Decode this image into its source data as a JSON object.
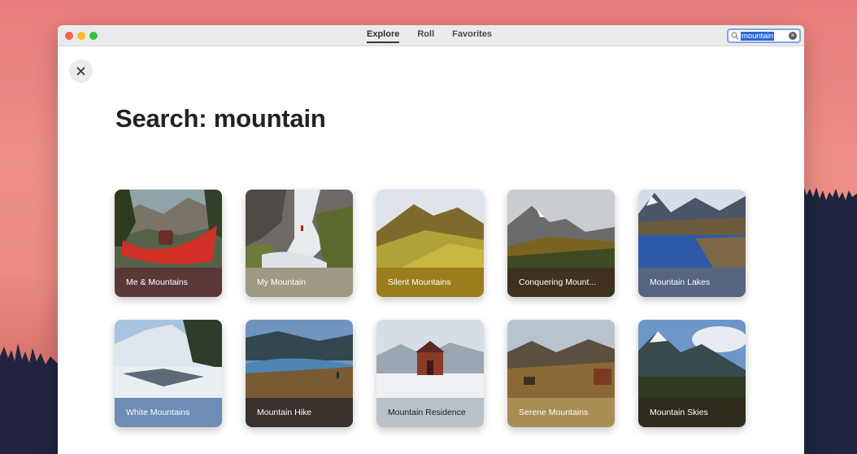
{
  "window": {
    "tabs": [
      {
        "label": "Explore",
        "active": true
      },
      {
        "label": "Roll",
        "active": false
      },
      {
        "label": "Favorites",
        "active": false
      }
    ],
    "search": {
      "value": "mountain",
      "icon": "search-icon"
    },
    "close_icon": "close-icon"
  },
  "main": {
    "heading": "Search: mountain",
    "cards": [
      {
        "label": "Me & Mountains",
        "bar_color": "#5b3838"
      },
      {
        "label": "My Mountain",
        "bar_color": "#9e9885"
      },
      {
        "label": "Silent Mountains",
        "bar_color": "#9a7d1c"
      },
      {
        "label": "Conquering Mount...",
        "bar_color": "#3e3120"
      },
      {
        "label": "Mountain Lakes",
        "bar_color": "#566580"
      },
      {
        "label": "White Mountains",
        "bar_color": "#6d8db5"
      },
      {
        "label": "Mountain Hike",
        "bar_color": "#3a302c"
      },
      {
        "label": "Mountain Residence",
        "bar_color": "#b8c0c8"
      },
      {
        "label": "Serene Mountains",
        "bar_color": "#a88d55"
      },
      {
        "label": "Mountain Skies",
        "bar_color": "#2f2b1d"
      }
    ]
  },
  "colors": {
    "desktop": "#ec8c82",
    "search_highlight": "#2f66d0",
    "search_border": "#7aa7e6"
  }
}
